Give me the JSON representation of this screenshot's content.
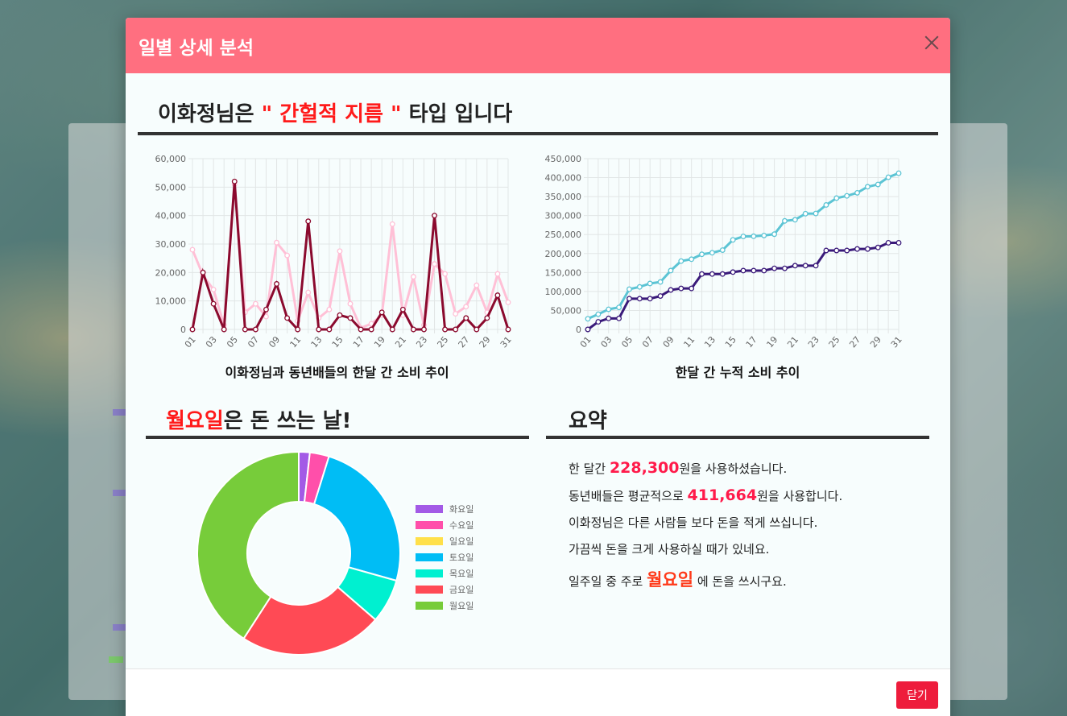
{
  "modal": {
    "title": "일별 상세 분석",
    "close_button_label": "닫기"
  },
  "headline": {
    "prefix": "이화정님은 ",
    "type_text": "\" 간헐적 지름 \"",
    "suffix": " 타입 입니다"
  },
  "captions": {
    "daily_chart": "이화정님과 동년배들의 한달 간 소비 추이",
    "cumulative_chart": "한달 간 누적 소비 추이"
  },
  "weekday_section": {
    "day": "월요일",
    "rest": "은 돈 쓰는 날!"
  },
  "summary_section": {
    "title": "요약",
    "line1_pre": "한 달간 ",
    "line1_num": "228,300",
    "line1_post": "원을 사용하셨습니다.",
    "line2_pre": "동년배들은 평균적으로 ",
    "line2_num": "411,664",
    "line2_post": "원을 사용합니다.",
    "line3": "이화정님은 다른 사람들 보다 돈을 적게 쓰십니다.",
    "line4": "가끔씩 돈을 크게 사용하실 때가 있네요.",
    "line5_pre": "일주일 중 주로 ",
    "line5_day": "월요일",
    "line5_post": " 에 돈을 쓰시구요."
  },
  "colors": {
    "header": "#ff6f80",
    "user_line": "#8b0a2e",
    "peer_line": "#ffc0d6",
    "cum_user": "#3a1a7a",
    "cum_peer": "#5cc4d4",
    "close_button": "#ee1c3c"
  },
  "chart_data": [
    {
      "type": "line",
      "title": "이화정님과 동년배들의 한달 간 소비 추이",
      "x": [
        "01",
        "02",
        "03",
        "04",
        "05",
        "06",
        "07",
        "08",
        "09",
        "10",
        "11",
        "12",
        "13",
        "14",
        "15",
        "16",
        "17",
        "18",
        "19",
        "20",
        "21",
        "22",
        "23",
        "24",
        "25",
        "26",
        "27",
        "28",
        "29",
        "30",
        "31"
      ],
      "x_tick_labels": [
        "01",
        "03",
        "05",
        "07",
        "09",
        "11",
        "13",
        "15",
        "17",
        "19",
        "21",
        "23",
        "25",
        "27",
        "29",
        "31"
      ],
      "ylim": [
        0,
        60000
      ],
      "y_ticks": [
        "0",
        "10,000",
        "20,000",
        "30,000",
        "40,000",
        "50,000",
        "60,000"
      ],
      "grid": true,
      "series": [
        {
          "values": [
            0,
            20000,
            9000,
            0,
            52000,
            0,
            0,
            7000,
            16000,
            4000,
            0,
            38000,
            0,
            0,
            5000,
            4000,
            0,
            0,
            6000,
            0,
            7000,
            0,
            0,
            40000,
            0,
            0,
            4000,
            0,
            4000,
            12000,
            0
          ]
        },
        {
          "values": [
            28000,
            19000,
            14000,
            1500,
            51000,
            6000,
            9000,
            4500,
            30500,
            26000,
            3000,
            13000,
            4000,
            7000,
            27500,
            9000,
            500,
            2000,
            5000,
            37000,
            5000,
            18500,
            1500,
            23000,
            19500,
            5500,
            8000,
            15500,
            6000,
            19500,
            9500
          ]
        }
      ]
    },
    {
      "type": "line",
      "title": "한달 간 누적 소비 추이",
      "x": [
        "01",
        "02",
        "03",
        "04",
        "05",
        "06",
        "07",
        "08",
        "09",
        "10",
        "11",
        "12",
        "13",
        "14",
        "15",
        "16",
        "17",
        "18",
        "19",
        "20",
        "21",
        "22",
        "23",
        "24",
        "25",
        "26",
        "27",
        "28",
        "29",
        "30",
        "31"
      ],
      "x_tick_labels": [
        "01",
        "03",
        "05",
        "07",
        "09",
        "11",
        "13",
        "15",
        "17",
        "19",
        "21",
        "23",
        "25",
        "27",
        "29",
        "31"
      ],
      "ylim": [
        0,
        450000
      ],
      "y_ticks": [
        "0",
        "50,000",
        "100,000",
        "150,000",
        "200,000",
        "250,000",
        "300,000",
        "350,000",
        "400,000",
        "450,000"
      ],
      "grid": true,
      "series": [
        {
          "values": [
            0,
            20000,
            29000,
            29000,
            81000,
            81000,
            81000,
            88000,
            104000,
            108000,
            108000,
            146000,
            146000,
            146000,
            151000,
            155000,
            155000,
            155000,
            161000,
            161000,
            168000,
            168000,
            168000,
            208000,
            208000,
            208000,
            212000,
            212000,
            216000,
            228300,
            228300
          ]
        },
        {
          "values": [
            28000,
            40000,
            53000,
            58000,
            106000,
            112000,
            121000,
            125000,
            155000,
            180000,
            185000,
            198000,
            202000,
            209000,
            236000,
            245000,
            245500,
            247500,
            251000,
            286000,
            289000,
            305000,
            305500,
            328000,
            346000,
            352000,
            360000,
            376000,
            382000,
            401000,
            411664
          ]
        }
      ]
    },
    {
      "type": "pie",
      "title": "",
      "categories": [
        "화요일",
        "수요일",
        "일요일",
        "토요일",
        "목요일",
        "금요일",
        "월요일"
      ],
      "values": [
        4000,
        7000,
        0,
        56000,
        16000,
        52000,
        93300
      ],
      "colors": [
        "#a35ae6",
        "#ff4faa",
        "#ffe04a",
        "#00bdf5",
        "#00f0d0",
        "#ff4a55",
        "#77cc3a"
      ]
    }
  ]
}
